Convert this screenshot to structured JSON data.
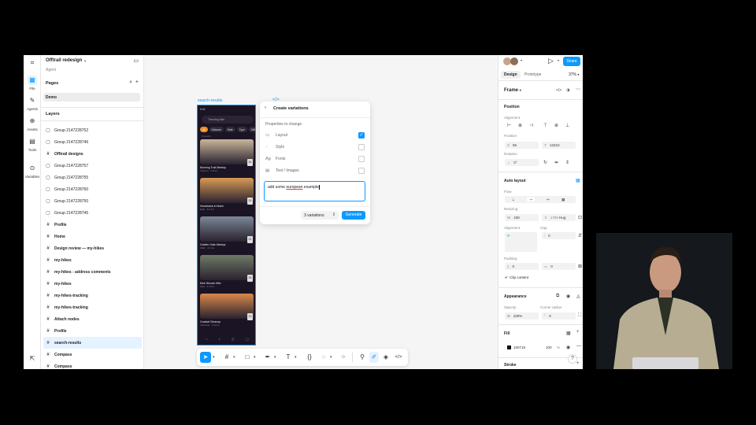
{
  "app": {
    "project_title": "Offtrail redesign",
    "project_subtitle": "Agent"
  },
  "rail": {
    "items": [
      {
        "label": "File",
        "icon": "file-icon"
      },
      {
        "label": "Agents",
        "icon": "agents-icon"
      },
      {
        "label": "Assets",
        "icon": "assets-icon"
      },
      {
        "label": "Tools",
        "icon": "tools-icon"
      },
      {
        "label": "Variables",
        "icon": "variables-icon"
      }
    ]
  },
  "pages": {
    "label": "Pages",
    "current": "Demo"
  },
  "layers": {
    "label": "Layers",
    "items": [
      {
        "name": "Group 2147228752",
        "type": "group"
      },
      {
        "name": "Group 2147228746",
        "type": "group"
      },
      {
        "name": "Offtrail designs",
        "type": "frame"
      },
      {
        "name": "Group 2147228757",
        "type": "group"
      },
      {
        "name": "Group 2147228755",
        "type": "group"
      },
      {
        "name": "Group 2147228760",
        "type": "group"
      },
      {
        "name": "Group 2147228750",
        "type": "group"
      },
      {
        "name": "Group 2147228745",
        "type": "group"
      },
      {
        "name": "Profile",
        "type": "frame"
      },
      {
        "name": "Home",
        "type": "frame"
      },
      {
        "name": "Design review — my-hikes",
        "type": "frame"
      },
      {
        "name": "my-hikes",
        "type": "frame"
      },
      {
        "name": "my-hikes - address comments",
        "type": "frame"
      },
      {
        "name": "my-hikes",
        "type": "frame"
      },
      {
        "name": "my-hikes-tracking",
        "type": "frame"
      },
      {
        "name": "my-hikes-tracking",
        "type": "frame"
      },
      {
        "name": "Attach nodes",
        "type": "frame"
      },
      {
        "name": "Profile",
        "type": "frame"
      },
      {
        "name": "search-results",
        "type": "frame",
        "selected": true
      },
      {
        "name": "Compass",
        "type": "frame"
      },
      {
        "name": "Compass",
        "type": "frame"
      }
    ]
  },
  "canvas": {
    "frame_label": "search-results",
    "phone": {
      "status_time": "9:41",
      "search_text": "Trending hike",
      "chips": [
        "All",
        "Distance",
        "Rate",
        "Type",
        "Difficulty"
      ],
      "meta": "8 results",
      "cards": [
        {
          "title": "Morning Trail Meetup",
          "sub": "Trail run · 4.8 km",
          "badge": "26",
          "color": "#c9b79a"
        },
        {
          "title": "Horseback in Marin",
          "sub": "Ride · 5.2 km",
          "badge": "25",
          "color": "#d89a55"
        },
        {
          "title": "Golden Gate Meetup",
          "sub": "Walk · 3.1 km",
          "badge": "02",
          "color": "#7b8795"
        },
        {
          "title": "Muir Woods Hike",
          "sub": "Hike · 6.4 km",
          "badge": "26",
          "color": "#6f7a66"
        },
        {
          "title": "Coastal Cleanup",
          "sub": "Volunteer · 2.0 km",
          "badge": "10",
          "color": "#d9884a"
        }
      ]
    }
  },
  "variations": {
    "title": "Create variations",
    "subtitle": "Properties to change",
    "properties": [
      {
        "label": "Layout",
        "icon": "layout-icon",
        "checked": true
      },
      {
        "label": "Style",
        "icon": "style-icon",
        "checked": false
      },
      {
        "label": "Fonts",
        "icon": "fonts-icon",
        "checked": false
      },
      {
        "label": "Text / Images",
        "icon": "text-images-icon",
        "checked": false
      }
    ],
    "prompt_before": "add some ",
    "prompt_misspelled": "european",
    "prompt_after": " example",
    "count": "3 variations",
    "generate": "Generate"
  },
  "right": {
    "share": "Share",
    "tab_design": "Design",
    "tab_prototype": "Prototype",
    "zoom": "37%",
    "frame_type": "Frame",
    "position": {
      "label": "Position",
      "alignment_label": "Alignment",
      "position_label": "Position",
      "x": "56",
      "y": "12210",
      "rotation_label": "Rotation",
      "rotation": "0°"
    },
    "auto_layout": {
      "label": "Auto layout",
      "flow_label": "Flow",
      "resizing_label": "Resizing",
      "width": "430",
      "height": "1769",
      "height_mode": "Hug",
      "alignment_label": "Alignment",
      "gap_label": "Gap",
      "gap": "0",
      "padding_label": "Padding",
      "padding_h": "0",
      "padding_v": "0",
      "clip": "Clip content"
    },
    "appearance": {
      "label": "Appearance",
      "opacity_label": "Opacity",
      "opacity": "100%",
      "radius_label": "Corner radius",
      "radius": "0"
    },
    "fill": {
      "label": "Fill",
      "hex": "100718",
      "alpha": "100",
      "unit": "%",
      "color": "#100718"
    },
    "stroke": {
      "label": "Stroke"
    }
  },
  "colors": {
    "accent": "#0d99ff"
  }
}
